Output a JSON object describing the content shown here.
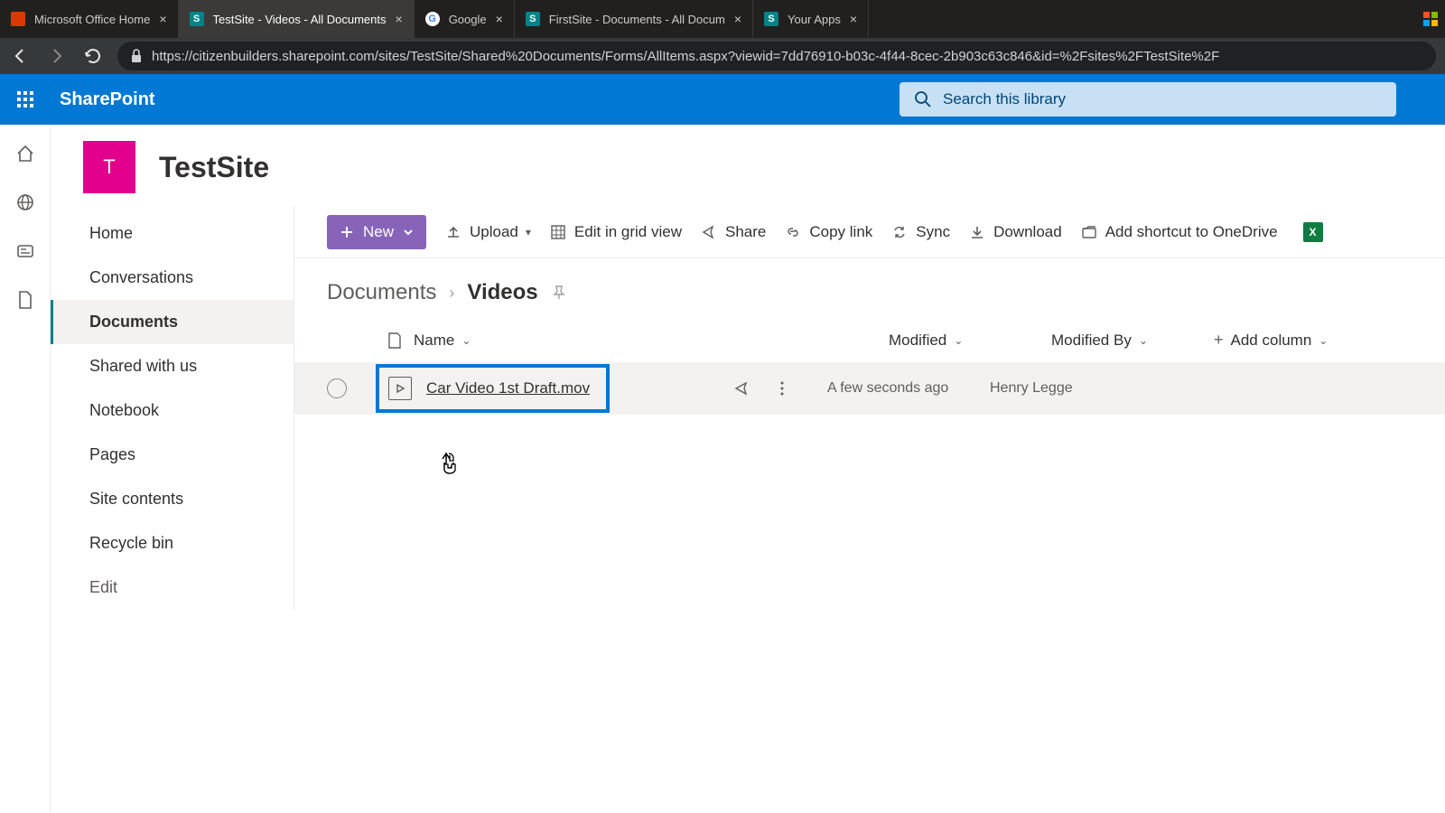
{
  "tabs": [
    {
      "title": "Microsoft Office Home",
      "favicon": "red",
      "letter": ""
    },
    {
      "title": "TestSite - Videos - All Documents",
      "favicon": "sp",
      "letter": "S",
      "active": true
    },
    {
      "title": "Google",
      "favicon": "g",
      "letter": "G"
    },
    {
      "title": "FirstSite - Documents - All Docum",
      "favicon": "sp",
      "letter": "S"
    },
    {
      "title": "Your Apps",
      "favicon": "sp",
      "letter": "S"
    }
  ],
  "url": "https://citizenbuilders.sharepoint.com/sites/TestSite/Shared%20Documents/Forms/AllItems.aspx?viewid=7dd76910-b03c-4f44-8cec-2b903c63c846&id=%2Fsites%2FTestSite%2F",
  "suite": {
    "name": "SharePoint",
    "search_placeholder": "Search this library"
  },
  "site": {
    "logo_letter": "T",
    "title": "TestSite"
  },
  "leftnav": [
    "Home",
    "Conversations",
    "Documents",
    "Shared with us",
    "Notebook",
    "Pages",
    "Site contents",
    "Recycle bin",
    "Edit"
  ],
  "leftnav_selected": "Documents",
  "commands": {
    "new": "New",
    "upload": "Upload",
    "editgrid": "Edit in grid view",
    "share": "Share",
    "copylink": "Copy link",
    "sync": "Sync",
    "download": "Download",
    "shortcut": "Add shortcut to OneDrive"
  },
  "breadcrumb": {
    "parent": "Documents",
    "current": "Videos"
  },
  "columns": {
    "name": "Name",
    "modified": "Modified",
    "modifiedby": "Modified By",
    "add": "Add column"
  },
  "rows": [
    {
      "name": "Car Video 1st Draft.mov",
      "modified": "A few seconds ago",
      "modifiedby": "Henry Legge"
    }
  ]
}
